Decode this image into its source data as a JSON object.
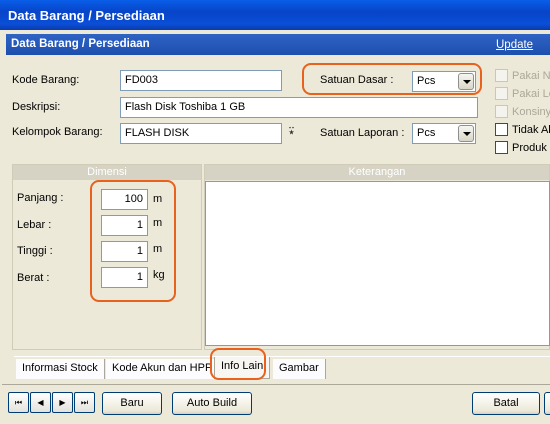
{
  "window": {
    "title": "Data Barang / Persediaan"
  },
  "header": {
    "title": "Data Barang / Persediaan",
    "mode": "Update"
  },
  "form": {
    "kode_label": "Kode Barang:",
    "kode_value": "FD003",
    "deskripsi_label": "Deskripsi:",
    "deskripsi_value": "Flash Disk Toshiba 1 GB",
    "kelompok_label": "Kelompok Barang:",
    "kelompok_value": "FLASH DISK",
    "satuan_dasar_label": "Satuan Dasar  :",
    "satuan_dasar_value": "Pcs",
    "satuan_laporan_label": "Satuan Laporan :",
    "satuan_laporan_value": "Pcs"
  },
  "options": [
    {
      "label": "Pakai No",
      "checked": false,
      "enabled": false
    },
    {
      "label": "Pakai Lo",
      "checked": false,
      "enabled": false
    },
    {
      "label": "Konsinya",
      "checked": false,
      "enabled": false
    },
    {
      "label": "Tidak Ak",
      "checked": false,
      "enabled": true
    },
    {
      "label": "Produk M",
      "checked": false,
      "enabled": true
    }
  ],
  "dimensi": {
    "title": "Dimensi",
    "panjang_label": "Panjang :",
    "panjang_value": "100",
    "panjang_unit": "m",
    "lebar_label": "Lebar :",
    "lebar_value": "1",
    "lebar_unit": "m",
    "tinggi_label": "Tinggi :",
    "tinggi_value": "1",
    "tinggi_unit": "m",
    "berat_label": "Berat :",
    "berat_value": "1",
    "berat_unit": "kg"
  },
  "keterangan": {
    "title": "Keterangan",
    "value": ""
  },
  "tabs": [
    {
      "label": "Informasi Stock",
      "active": false
    },
    {
      "label": "Kode Akun dan HPP",
      "active": false
    },
    {
      "label": "Info Lain",
      "active": true
    },
    {
      "label": "Gambar",
      "active": false
    }
  ],
  "nav": {
    "first": "⏮",
    "prev": "◀",
    "next": "▶",
    "last": "⏭"
  },
  "buttons": {
    "baru": "Baru",
    "auto_build": "Auto Build",
    "batal": "Batal"
  },
  "colors": {
    "highlight": "#e8621e",
    "header_bar": "#1d4fae",
    "titlebar": "#0a4fd8"
  }
}
